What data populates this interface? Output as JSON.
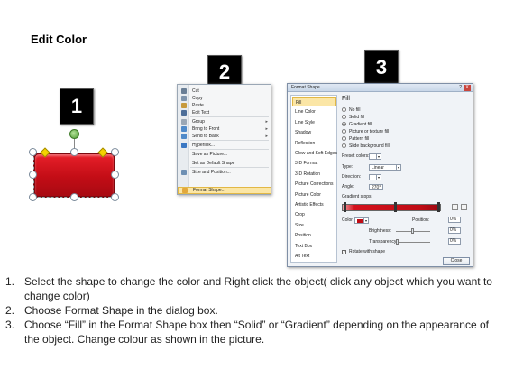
{
  "page_title": "Edit Color",
  "badges": [
    "1",
    "2",
    "3"
  ],
  "context_menu": {
    "items": [
      {
        "label": "Cut",
        "icon": "scissors-icon",
        "color": "#6a7f96"
      },
      {
        "label": "Copy",
        "icon": "copy-icon",
        "color": "#7f95ad"
      },
      {
        "label": "Paste",
        "icon": "paste-icon",
        "color": "#c79a3d"
      },
      {
        "label": "Edit Text",
        "icon": "text-icon",
        "color": "#4c6e99"
      },
      {
        "label": "Group",
        "icon": "group-icon",
        "color": "#9aa7b5",
        "submenu": true
      },
      {
        "label": "Bring to Front",
        "icon": "bring-front-icon",
        "color": "#4f8ac9",
        "submenu": true
      },
      {
        "label": "Send to Back",
        "icon": "send-back-icon",
        "color": "#4f8ac9",
        "submenu": true
      },
      {
        "label": "Hyperlink...",
        "icon": "hyperlink-icon",
        "color": "#3b78c3"
      },
      {
        "label": "Save as Picture...",
        "icon": "",
        "color": ""
      },
      {
        "label": "Set as Default Shape",
        "icon": "",
        "color": ""
      },
      {
        "label": "Size and Position...",
        "icon": "size-icon",
        "color": "#6d8fb3"
      },
      {
        "label": "Format Shape...",
        "icon": "format-shape-icon",
        "color": "#e2a83c",
        "highlighted": true
      }
    ]
  },
  "dialog": {
    "title": "Format Shape",
    "help": "?",
    "close_x": "X",
    "nav": [
      "Fill",
      "Line Color",
      "Line Style",
      "Shadow",
      "Reflection",
      "Glow and Soft Edges",
      "3-D Format",
      "3-D Rotation",
      "Picture Corrections",
      "Picture Color",
      "Artistic Effects",
      "Crop",
      "Size",
      "Position",
      "Text Box",
      "Alt Text"
    ],
    "selected_nav": "Fill",
    "fill_heading": "Fill",
    "fill_options": [
      {
        "label": "No fill",
        "checked": false
      },
      {
        "label": "Solid fill",
        "checked": false
      },
      {
        "label": "Gradient fill",
        "checked": true
      },
      {
        "label": "Picture or texture fill",
        "checked": false
      },
      {
        "label": "Pattern fill",
        "checked": false
      },
      {
        "label": "Slide background fill",
        "checked": false
      }
    ],
    "preset_colors_label": "Preset colors:",
    "type_label": "Type:",
    "type_value": "Linear",
    "direction_label": "Direction:",
    "angle_label": "Angle:",
    "angle_value": "270°",
    "gradient_stops_label": "Gradient stops",
    "color_label": "Color",
    "position_label": "Position:",
    "position_value": "0%",
    "brightness_label": "Brightness:",
    "brightness_value": "0%",
    "transparency_label": "Transparency:",
    "transparency_value": "0%",
    "rotate_label": "Rotate with shape",
    "rotate_checked": true,
    "close_button": "Close",
    "colors": {
      "gradient_dark": "#c00c15",
      "gradient_light": "#f2a3a7"
    }
  },
  "instructions": [
    {
      "num": "1.",
      "text": "Select the shape to change the color and Right click the object( click any object which you want to change color)"
    },
    {
      "num": "2.",
      "text": "Choose Format Shape in the dialog box."
    },
    {
      "num": "3.",
      "text": "Choose “Fill” in the Format Shape box then “Solid” or “Gradient” depending on the appearance of the object. Change colour as shown in the picture."
    }
  ],
  "colors": {
    "shape_red": "#c30d16",
    "badge_bg": "#000000"
  }
}
